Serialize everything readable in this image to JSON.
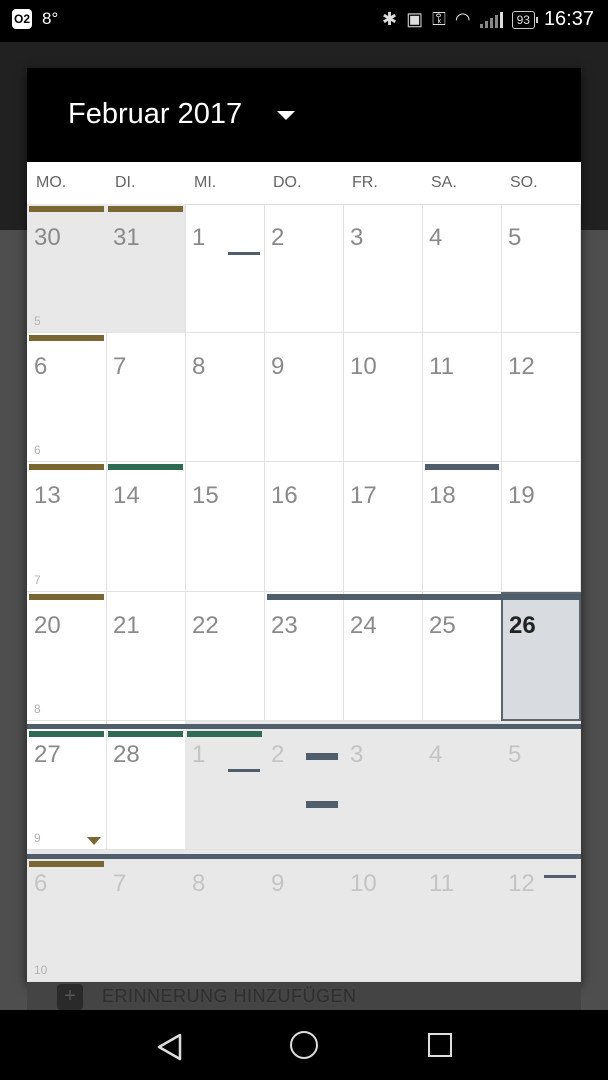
{
  "status_bar": {
    "carrier": "O2",
    "temperature": "8°",
    "battery": "93",
    "time": "16:37",
    "icons": [
      "bluetooth-icon",
      "nfc-icon",
      "key-icon",
      "wifi-icon",
      "signal-icon",
      "battery-icon"
    ]
  },
  "calendar": {
    "month_title": "Februar 2017",
    "weekdays": [
      "MO.",
      "DI.",
      "MI.",
      "DO.",
      "FR.",
      "SA.",
      "SO."
    ],
    "weeks": [
      {
        "week_number": "5",
        "days": [
          {
            "d": "30",
            "state": "out"
          },
          {
            "d": "31",
            "state": "out"
          },
          {
            "d": "1"
          },
          {
            "d": "2"
          },
          {
            "d": "3"
          },
          {
            "d": "4"
          },
          {
            "d": "5"
          }
        ]
      },
      {
        "week_number": "6",
        "days": [
          {
            "d": "6"
          },
          {
            "d": "7"
          },
          {
            "d": "8"
          },
          {
            "d": "9"
          },
          {
            "d": "10"
          },
          {
            "d": "11"
          },
          {
            "d": "12"
          }
        ]
      },
      {
        "week_number": "7",
        "days": [
          {
            "d": "13"
          },
          {
            "d": "14"
          },
          {
            "d": "15"
          },
          {
            "d": "16"
          },
          {
            "d": "17"
          },
          {
            "d": "18"
          },
          {
            "d": "19"
          }
        ]
      },
      {
        "week_number": "8",
        "days": [
          {
            "d": "20"
          },
          {
            "d": "21"
          },
          {
            "d": "22"
          },
          {
            "d": "23"
          },
          {
            "d": "24"
          },
          {
            "d": "25"
          },
          {
            "d": "26",
            "state": "today"
          }
        ]
      },
      {
        "week_number": "9",
        "days": [
          {
            "d": "27"
          },
          {
            "d": "28"
          },
          {
            "d": "1",
            "state": "fade"
          },
          {
            "d": "2",
            "state": "fade"
          },
          {
            "d": "3",
            "state": "fade"
          },
          {
            "d": "4",
            "state": "fade"
          },
          {
            "d": "5",
            "state": "fade"
          }
        ]
      },
      {
        "week_number": "10",
        "days": [
          {
            "d": "6",
            "state": "fade"
          },
          {
            "d": "7",
            "state": "fade"
          },
          {
            "d": "8",
            "state": "fade"
          },
          {
            "d": "9",
            "state": "fade"
          },
          {
            "d": "10",
            "state": "fade"
          },
          {
            "d": "11",
            "state": "fade"
          },
          {
            "d": "12",
            "state": "fade"
          }
        ]
      }
    ],
    "colors": {
      "olive": "#7a6632",
      "green": "#2f6a52",
      "slate": "#505e6c",
      "today_bg": "#d8dbdf"
    }
  },
  "reminder": {
    "label": "ERINNERUNG HINZUFÜGEN",
    "icon": "add-reminder-icon"
  },
  "nav": {
    "back": "back-icon",
    "home": "home-icon",
    "recents": "recents-icon"
  }
}
